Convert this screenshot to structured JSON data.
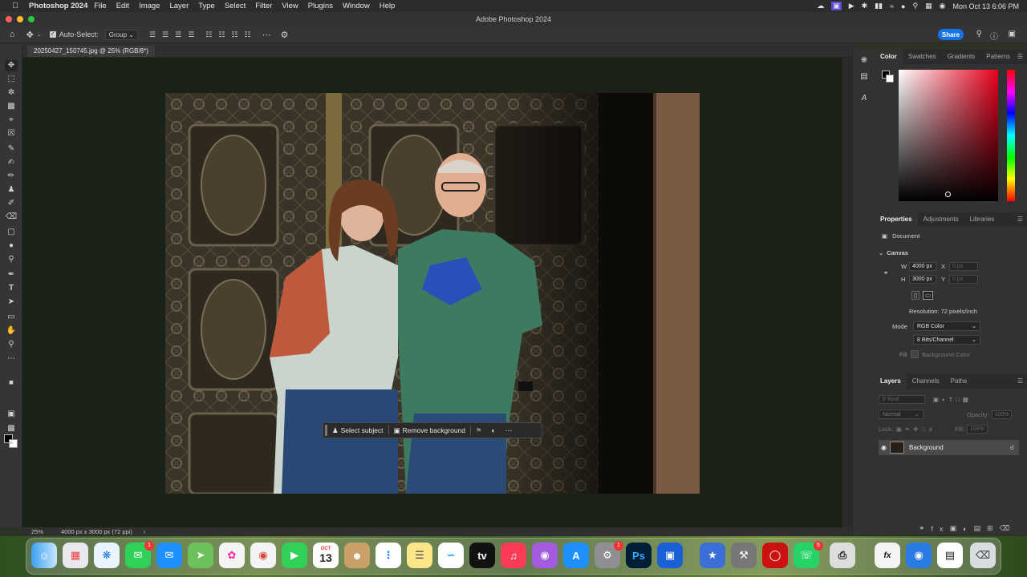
{
  "menubar": {
    "app_name": "Photoshop 2024",
    "items": [
      "File",
      "Edit",
      "Image",
      "Layer",
      "Type",
      "Select",
      "Filter",
      "View",
      "Plugins",
      "Window",
      "Help"
    ],
    "datetime": "Mon Oct 13  6:06 PM"
  },
  "window": {
    "title": "Adobe Photoshop 2024"
  },
  "options": {
    "auto_select_label": "Auto-Select:",
    "auto_select_value": "Group",
    "share_label": "Share"
  },
  "document": {
    "tab_title": "20250427_150745.jpg @ 25% (RGB/8*)"
  },
  "context_bar": {
    "select_subject": "Select subject",
    "remove_background": "Remove background"
  },
  "status": {
    "zoom": "25%",
    "info": "4000 px x 3000 px (72 ppi)"
  },
  "color_panel": {
    "tabs": [
      "Color",
      "Swatches",
      "Gradients",
      "Patterns"
    ],
    "active_tab": "Color"
  },
  "properties_panel": {
    "tabs": [
      "Properties",
      "Adjustments",
      "Libraries"
    ],
    "section": "Document",
    "canvas_header": "Canvas",
    "w_label": "W",
    "w_value": "4000 px",
    "h_label": "H",
    "h_value": "3000 px",
    "x_label": "X",
    "y_label": "Y",
    "x_placeholder": "0 px",
    "y_placeholder": "0 px",
    "resolution": "Resolution: 72 pixels/inch",
    "mode_label": "Mode",
    "mode_value": "RGB Color",
    "bits_value": "8 Bits/Channel",
    "fill_label": "Fill",
    "fill_value": "Background Color"
  },
  "layers_panel": {
    "tabs": [
      "Layers",
      "Channels",
      "Paths"
    ],
    "kind_placeholder": "Kind",
    "blend_mode": "Normal",
    "opacity_label": "Opacity:",
    "opacity_value": "100%",
    "lock_label": "Lock:",
    "fill_label": "Fill:",
    "fill_value": "100%",
    "layer_name": "Background"
  },
  "dock": {
    "calendar_month": "OCT",
    "calendar_day": "13",
    "badges": {
      "messages": "1",
      "reminders": "1",
      "whatsapp": "5"
    }
  }
}
